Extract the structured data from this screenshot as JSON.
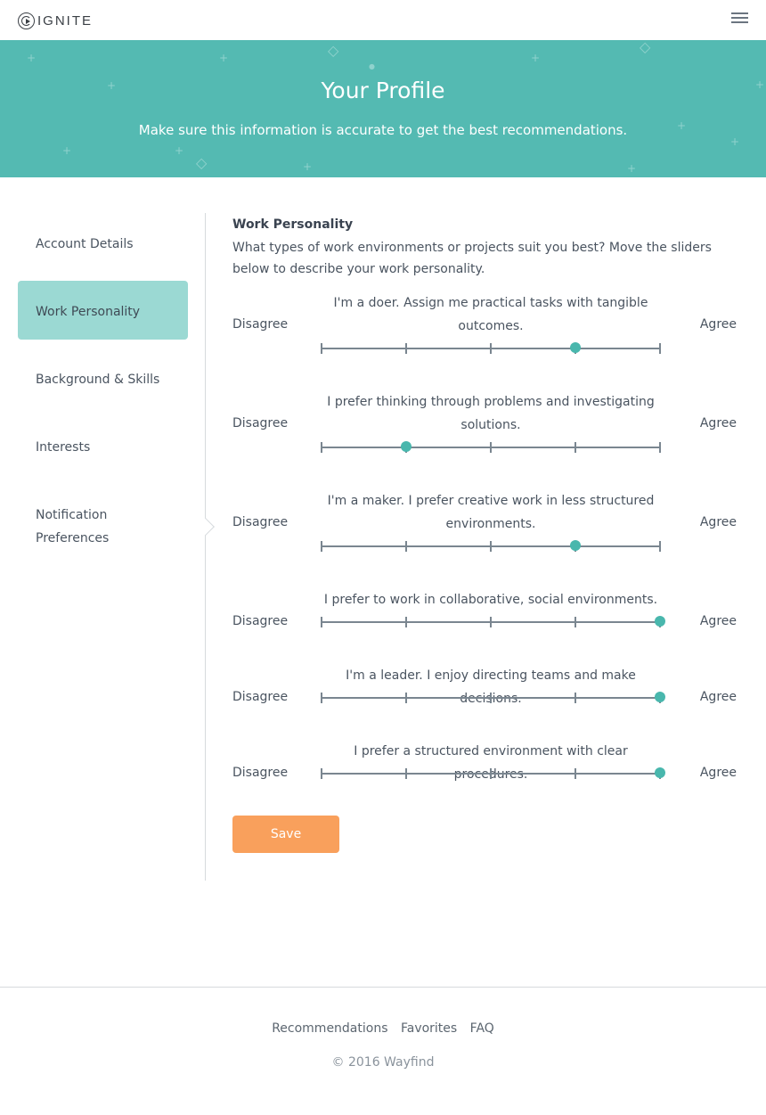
{
  "brand": {
    "logo_text": "IGNITE",
    "logo_icon": "ignite-logo-icon"
  },
  "header": {
    "menu_icon": "hamburger-menu-icon"
  },
  "hero": {
    "title": "Your Profile",
    "subtitle": "Make sure this information is accurate to get the best recommendations.",
    "background_color": "#54bab2"
  },
  "sidebar": {
    "items": [
      {
        "label": "Account Details",
        "active": false
      },
      {
        "label": "Work Personality",
        "active": true
      },
      {
        "label": "Background & Skills",
        "active": false
      },
      {
        "label": "Interests",
        "active": false
      },
      {
        "label_line1": "Notification",
        "label_line2": "Preferences",
        "active": false
      }
    ]
  },
  "main": {
    "title": "Work Personality",
    "description": "What types of work environments or projects suit you best? Move the sliders below to describe your work personality.",
    "disagree_label": "Disagree",
    "agree_label": "Agree",
    "sliders": [
      {
        "statement": "I'm a doer. Assign me practical tasks with tangible outcomes.",
        "value": 0.75
      },
      {
        "statement": "I prefer thinking through problems and investigating solutions.",
        "value": 0.25
      },
      {
        "statement": "I'm a maker. I prefer creative work in less structured environments.",
        "value": 0.75
      },
      {
        "statement": "I prefer to work in collaborative, social environments.",
        "value": 1.0
      },
      {
        "statement": "I'm a leader. I enjoy directing teams and make decisions.",
        "value": 1.0
      },
      {
        "statement": "I prefer a structured environment with clear procedures.",
        "value": 1.0
      }
    ],
    "save_label": "Save",
    "accent_color": "#49b7ad",
    "save_color": "#f9a05c"
  },
  "footer": {
    "links": [
      "Recommendations",
      "Favorites",
      "FAQ"
    ],
    "copyright": "© 2016 Wayfind"
  }
}
